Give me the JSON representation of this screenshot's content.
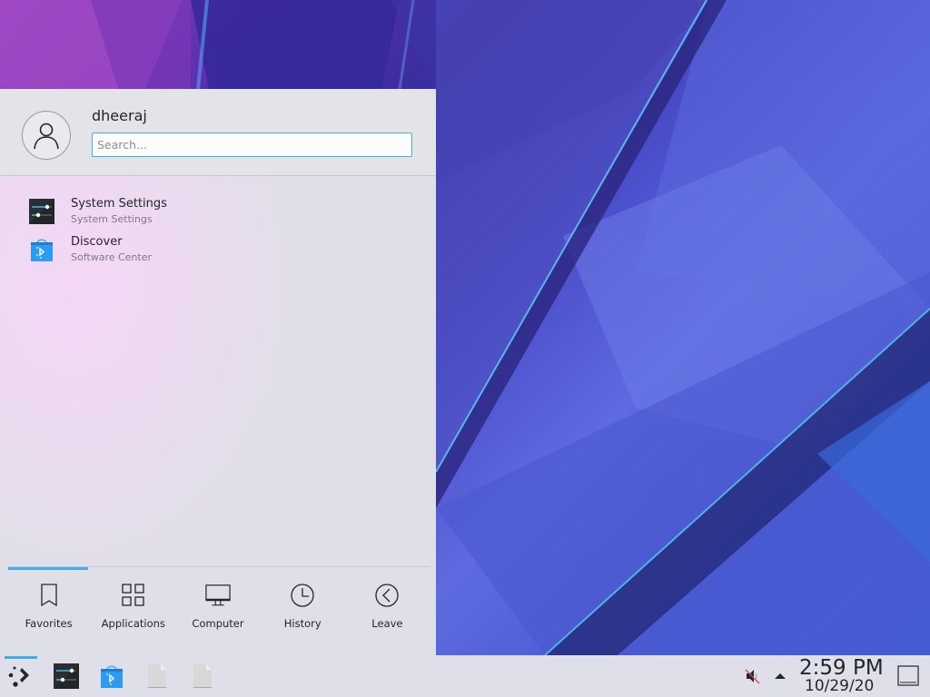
{
  "launcher": {
    "username": "dheeraj",
    "search_placeholder": "Search...",
    "search_value": "",
    "favorites": [
      {
        "title": "System Settings",
        "subtitle": "System Settings",
        "icon": "system-settings-icon"
      },
      {
        "title": "Discover",
        "subtitle": "Software Center",
        "icon": "discover-icon"
      }
    ],
    "tabs": [
      {
        "label": "Favorites",
        "icon": "bookmark-icon",
        "active": true
      },
      {
        "label": "Applications",
        "icon": "grid-icon",
        "active": false
      },
      {
        "label": "Computer",
        "icon": "monitor-icon",
        "active": false
      },
      {
        "label": "History",
        "icon": "clock-icon",
        "active": false
      },
      {
        "label": "Leave",
        "icon": "leave-icon",
        "active": false
      }
    ]
  },
  "taskbar": {
    "items": [
      {
        "name": "application-launcher",
        "icon": "kde-launcher-icon"
      },
      {
        "name": "system-settings",
        "icon": "system-settings-icon"
      },
      {
        "name": "discover",
        "icon": "discover-icon"
      },
      {
        "name": "file-1",
        "icon": "file-icon"
      },
      {
        "name": "file-2",
        "icon": "file-icon"
      }
    ],
    "tray": {
      "volume_state": "muted",
      "expand_icon": "arrow-up-icon"
    },
    "clock": {
      "time": "2:59 PM",
      "date": "10/29/20"
    },
    "show_desktop_icon": "show-desktop-icon"
  },
  "colors": {
    "accent": "#3daee9",
    "text": "#232629",
    "subtext": "#7b7c7e"
  }
}
